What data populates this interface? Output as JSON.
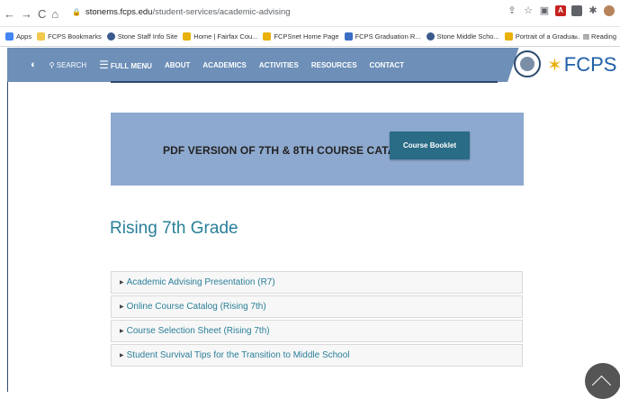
{
  "browser": {
    "nav_glyphs": "←→C⌂",
    "url_domain": "stonems.fcps.edu",
    "url_path": "/student-services/academic-advising",
    "right_icons": [
      "share-icon",
      "star-icon",
      "extension-icon",
      "pdf-icon",
      "extension2-icon",
      "puzzle-icon",
      "avatar-icon"
    ],
    "reading_list": "Reading",
    "more_bookmarks": "»"
  },
  "bookmarks": [
    {
      "label": "Apps",
      "color": "#4285f4"
    },
    {
      "label": "FCPS Bookmarks",
      "color": "#f2c94c"
    },
    {
      "label": "Stone Staff Info Site",
      "color": "#3a5a8c"
    },
    {
      "label": "Home | Fairfax Cou...",
      "color": "#e8b10b"
    },
    {
      "label": "FCPSnet Home Page",
      "color": "#e8b10b"
    },
    {
      "label": "FCPS Graduation R...",
      "color": "#3b6ec2"
    },
    {
      "label": "Stone Middle Scho...",
      "color": "#3a5a8c"
    },
    {
      "label": "Portrait of a Gradua...",
      "color": "#e8b10b"
    }
  ],
  "site_nav": {
    "search": "SEARCH",
    "full_menu": "FULL MENU",
    "items": [
      "ABOUT",
      "ACADEMICS",
      "ACTIVITIES",
      "RESOURCES",
      "CONTACT"
    ],
    "logo_text": "FCPS",
    "bg_color": "#6d8fb8"
  },
  "banner": {
    "text": "PDF VERSION OF 7TH & 8TH COURSE CATALOGS.",
    "button": "Course Booklet"
  },
  "main": {
    "heading": "Rising 7th Grade",
    "accordion": [
      "Academic Advising Presentation (R7)",
      "Online Course Catalog (Rising 7th)",
      "Course Selection Sheet (Rising 7th)",
      "Student Survival Tips for the Transition to Middle School"
    ]
  }
}
